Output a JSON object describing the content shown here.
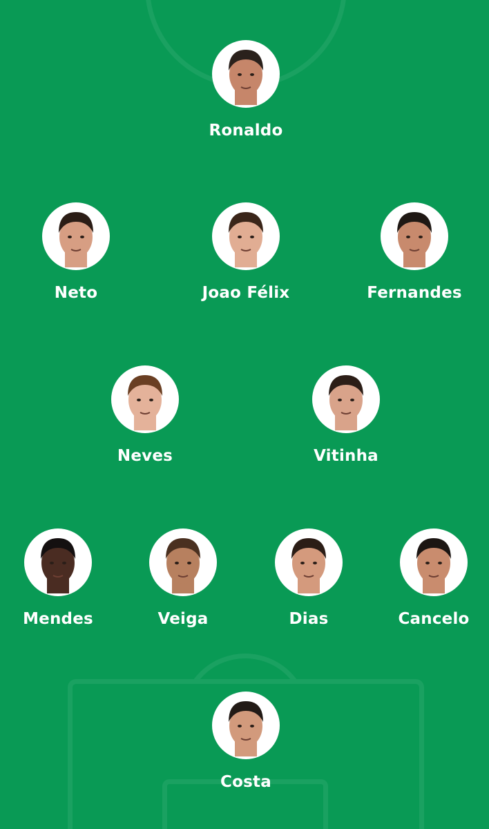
{
  "lineup": {
    "forward": [
      {
        "name": "Ronaldo",
        "skin": "#c6866a",
        "hair": "#2a211c"
      }
    ],
    "attacking": [
      {
        "name": "Neto",
        "skin": "#d79e83",
        "hair": "#2b1d16"
      },
      {
        "name": "Joao Félix",
        "skin": "#e1ad93",
        "hair": "#3a2519"
      },
      {
        "name": "Fernandes",
        "skin": "#c88a6d",
        "hair": "#1f1814"
      }
    ],
    "midfield": [
      {
        "name": "Neves",
        "skin": "#e4b29a",
        "hair": "#6a3f23"
      },
      {
        "name": "Vitinha",
        "skin": "#d9a38a",
        "hair": "#2c1e17"
      }
    ],
    "defence": [
      {
        "name": "Mendes",
        "skin": "#4a2c22",
        "hair": "#141010"
      },
      {
        "name": "Veiga",
        "skin": "#b7805f",
        "hair": "#4a3020"
      },
      {
        "name": "Dias",
        "skin": "#d49a7d",
        "hair": "#2b1d16"
      },
      {
        "name": "Cancelo",
        "skin": "#c98c6e",
        "hair": "#1c1613"
      }
    ],
    "goalkeeper": [
      {
        "name": "Costa",
        "skin": "#d29a7c",
        "hair": "#221a16"
      }
    ]
  },
  "colors": {
    "pitch": "#099a55",
    "lines": "rgba(255,255,255,0.07)",
    "text": "#ffffff"
  }
}
